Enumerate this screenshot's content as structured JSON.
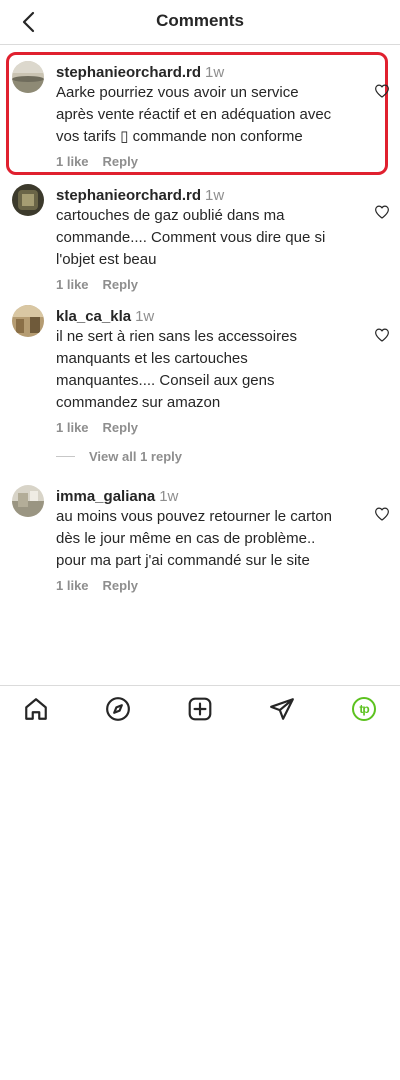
{
  "header": {
    "title": "Comments",
    "back_icon": "chevron-left-icon"
  },
  "comments": [
    {
      "username": "stephanieorchard.rd",
      "time": "1w",
      "text": "Aarke pourriez vous avoir un service\naprès vente réactif et en adéquation avec\nvos tarifs ▯ commande non conforme",
      "likes": "1 like",
      "reply": "Reply",
      "highlighted": true
    },
    {
      "username": "stephanieorchard.rd",
      "time": "1w",
      "text": "cartouches de gaz oublié dans ma\ncommande.... Comment vous dire que si\nl'objet est beau",
      "likes": "1 like",
      "reply": "Reply"
    },
    {
      "username": "kla_ca_kla",
      "time": "1w",
      "text": "il ne sert à rien sans les accessoires\nmanquants et les cartouches\nmanquantes.... Conseil aux gens\ncommandez sur amazon",
      "likes": "1 like",
      "reply": "Reply",
      "view_replies": "View all 1 reply"
    },
    {
      "username": "imma_galiana",
      "time": "1w",
      "text": "au moins vous pouvez retourner le carton\ndès le jour même en cas de problème..\npour ma part j'ai commandé sur le site",
      "likes": "1 like",
      "reply": "Reply"
    }
  ],
  "bottom_nav": {
    "items": [
      "home-icon",
      "explore-icon",
      "create-icon",
      "direct-message-icon",
      "profile-avatar"
    ],
    "profile_initials": "tp",
    "profile_color": "#5cc21f"
  },
  "colors": {
    "highlight": "#e0202f",
    "muted": "#8e8e8e",
    "text": "#262626"
  }
}
